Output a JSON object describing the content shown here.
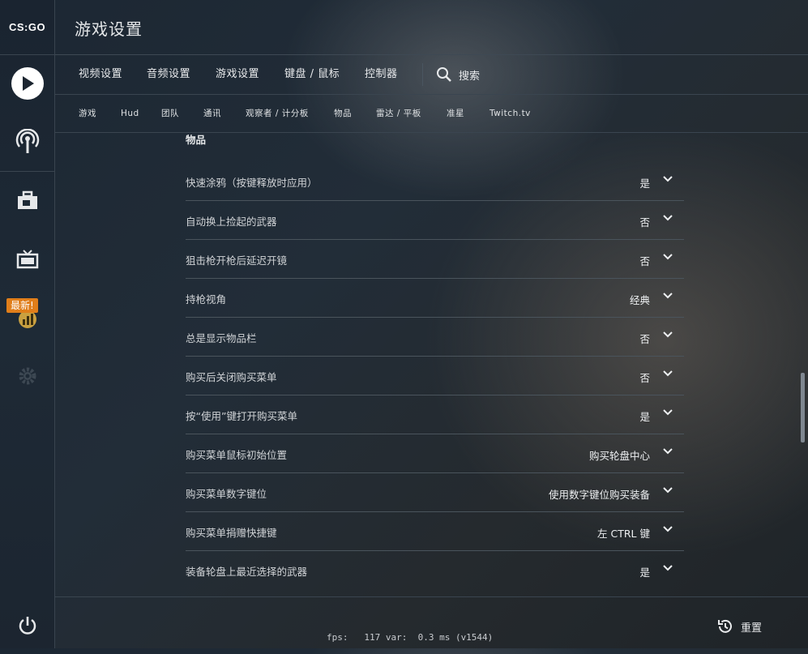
{
  "logo": "CS:GO",
  "header": {
    "title": "游戏设置"
  },
  "tabs": [
    {
      "label": "视频设置"
    },
    {
      "label": "音频设置"
    },
    {
      "label": "游戏设置"
    },
    {
      "label": "键盘 / 鼠标"
    },
    {
      "label": "控制器"
    }
  ],
  "search": {
    "label": "搜索"
  },
  "subtabs": [
    {
      "label": "游戏"
    },
    {
      "label": "Hud"
    },
    {
      "label": "团队"
    },
    {
      "label": "通讯"
    },
    {
      "label": "观察者 / 计分板"
    },
    {
      "label": "物品"
    },
    {
      "label": "雷达 / 平板"
    },
    {
      "label": "准星"
    },
    {
      "label": "Twitch.tv"
    }
  ],
  "sidebar": {
    "badge": "最新!"
  },
  "section": {
    "title": "物品"
  },
  "settings": [
    {
      "label": "快速涂鸦（按键释放时应用）",
      "value": "是"
    },
    {
      "label": "自动换上捡起的武器",
      "value": "否"
    },
    {
      "label": "狙击枪开枪后延迟开镜",
      "value": "否"
    },
    {
      "label": "持枪视角",
      "value": "经典"
    },
    {
      "label": "总是显示物品栏",
      "value": "否"
    },
    {
      "label": "购买后关闭购买菜单",
      "value": "否"
    },
    {
      "label": "按“使用”键打开购买菜单",
      "value": "是"
    },
    {
      "label": "购买菜单鼠标初始位置",
      "value": "购买轮盘中心"
    },
    {
      "label": "购买菜单数字键位",
      "value": "使用数字键位购买装备"
    },
    {
      "label": "购买菜单捐赠快捷键",
      "value": "左 CTRL 键"
    },
    {
      "label": "装备轮盘上最近选择的武器",
      "value": "是"
    }
  ],
  "footer": {
    "fps": "fps:   117 var:  0.3 ms (v1544)",
    "reset_label": "重置"
  }
}
